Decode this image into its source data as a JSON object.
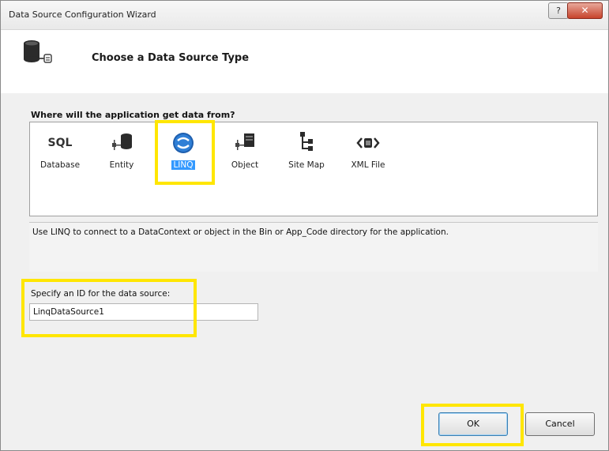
{
  "window": {
    "title": "Data Source Configuration Wizard",
    "help_label": "?",
    "close_label": "✕"
  },
  "header": {
    "title": "Choose a Data Source Type",
    "icon": "database-connect-icon"
  },
  "source_types": {
    "label": "Where will the application get data from?",
    "items": [
      {
        "label": "Database",
        "icon": "sql-icon",
        "glyph": "SQL"
      },
      {
        "label": "Entity",
        "icon": "entity-icon"
      },
      {
        "label": "LINQ",
        "icon": "linq-icon",
        "selected": true
      },
      {
        "label": "Object",
        "icon": "object-icon"
      },
      {
        "label": "Site Map",
        "icon": "sitemap-icon"
      },
      {
        "label": "XML File",
        "icon": "xml-file-icon"
      }
    ],
    "description": "Use LINQ to connect to a DataContext or object in the Bin or App_Code directory for the application."
  },
  "id_field": {
    "label": "Specify an ID for the data source:",
    "value": "LinqDataSource1"
  },
  "buttons": {
    "ok": "OK",
    "cancel": "Cancel"
  },
  "colors": {
    "highlight": "#ffe600",
    "selection": "#3399ff",
    "close": "#c7442c"
  }
}
